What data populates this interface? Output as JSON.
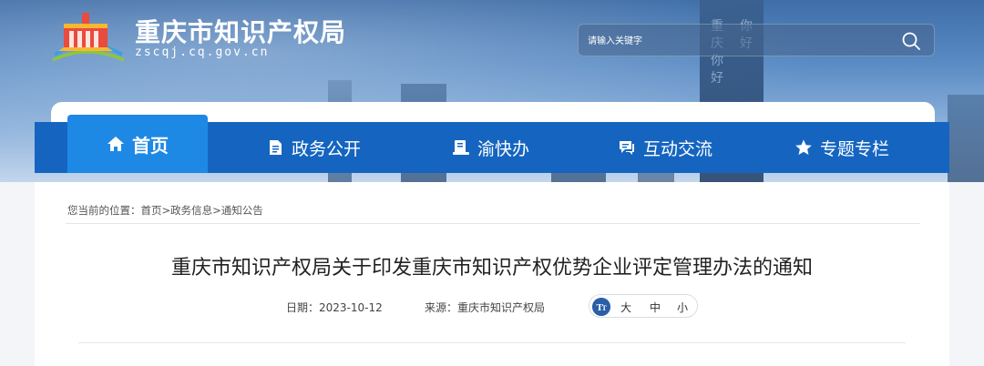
{
  "header": {
    "site_title": "重庆市知识产权局",
    "site_domain": "zscqj.cq.gov.cn",
    "tower_text_1": "重庆你好",
    "tower_text_2": "你好"
  },
  "search": {
    "placeholder": "请输入关键字"
  },
  "nav": {
    "items": [
      {
        "label": "首页",
        "icon": "home-icon",
        "active": true
      },
      {
        "label": "政务公开",
        "icon": "document-icon"
      },
      {
        "label": "渝快办",
        "icon": "service-icon"
      },
      {
        "label": "互动交流",
        "icon": "chat-icon"
      },
      {
        "label": "专题专栏",
        "icon": "star-icon"
      }
    ]
  },
  "breadcrumb": {
    "prefix": "您当前的位置：",
    "items": [
      "首页",
      "政务信息",
      "通知公告"
    ],
    "separator": ">"
  },
  "article": {
    "title": "重庆市知识产权局关于印发重庆市知识产权优势企业评定管理办法的通知",
    "date_label": "日期：",
    "date": "2023-10-12",
    "source_label": "来源：",
    "source": "重庆市知识产权局"
  },
  "font_size": {
    "options": [
      "大",
      "中",
      "小"
    ]
  },
  "colors": {
    "nav_bg": "#1565c0",
    "nav_active": "#1e88e5",
    "title_text": "#222222"
  }
}
